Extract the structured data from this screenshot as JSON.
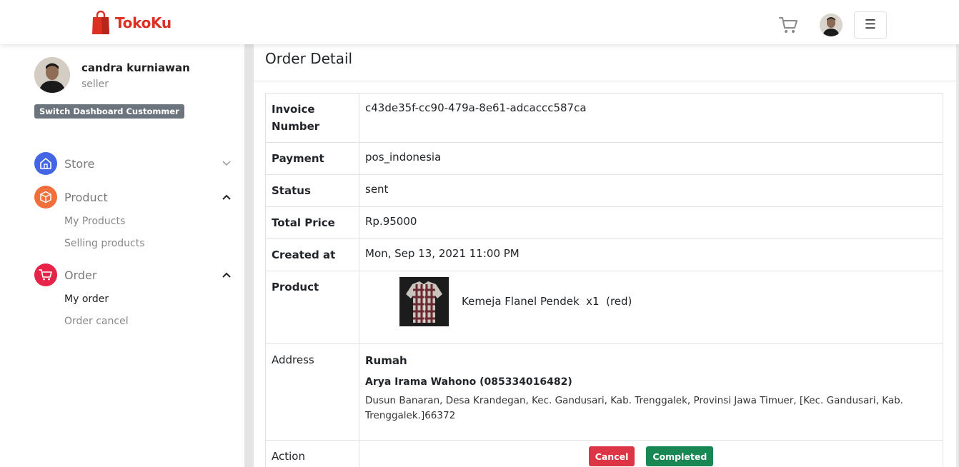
{
  "header": {
    "brand": "TokoKu",
    "brand_color": "#db3022",
    "cart_icon": "cart-icon",
    "menu_icon": "hamburger-menu-icon"
  },
  "sidebar": {
    "user_name": "candra kurniawan",
    "user_role": "seller",
    "switch_label": "Switch Dashboard Custommer",
    "groups": [
      {
        "label": "Store",
        "icon": "store-icon",
        "color": "#4466e5",
        "expanded": false,
        "items": []
      },
      {
        "label": "Product",
        "icon": "box-icon",
        "color": "#f06f3d",
        "expanded": true,
        "items": [
          "My Products",
          "Selling products"
        ]
      },
      {
        "label": "Order",
        "icon": "cart-icon",
        "color": "#e8234a",
        "expanded": true,
        "items": [
          "My order",
          "Order cancel"
        ],
        "active_item": "My order"
      }
    ]
  },
  "main": {
    "title": "Order Detail",
    "rows": {
      "invoice_label": "Invoice Number",
      "invoice_value": "c43de35f-cc90-479a-8e61-adcaccc587ca",
      "payment_label": "Payment",
      "payment_value": "pos_indonesia",
      "status_label": "Status",
      "status_value": "sent",
      "total_label": "Total Price",
      "total_value": "Rp.95000",
      "created_label": "Created at",
      "created_value": "Mon, Sep 13, 2021 11:00 PM",
      "product_label": "Product",
      "product_value": "Kemeja Flanel Pendek  x1  (red)",
      "address_label": "Address",
      "address_title": "Rumah",
      "address_name": "Arya Irama Wahono (085334016482)",
      "address_text": "Dusun Banaran, Desa Krandegan, Kec. Gandusari, Kab. Trenggalek, Provinsi Jawa Timuer, [Kec. Gandusari, Kab. Trenggalek.]66372",
      "action_label": "Action",
      "cancel_label": "Cancel",
      "complete_label": "Completed"
    }
  }
}
